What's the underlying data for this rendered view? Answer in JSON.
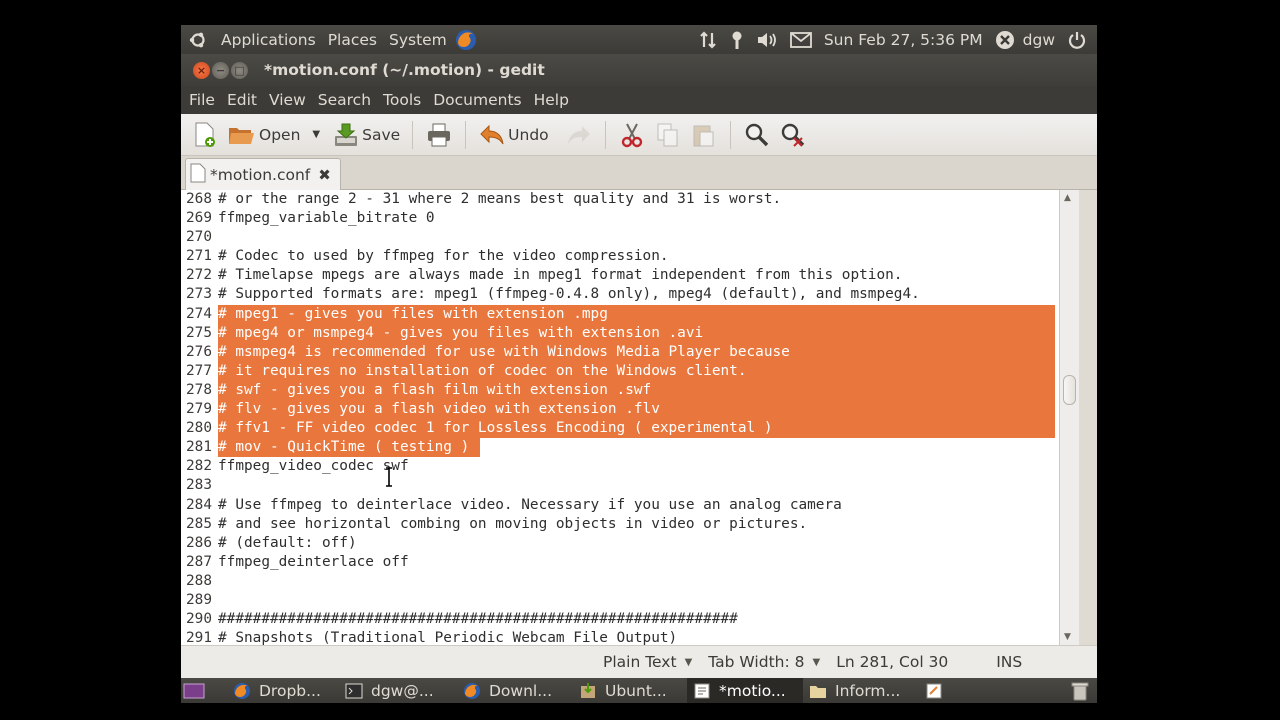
{
  "top_panel": {
    "menus": [
      "Applications",
      "Places",
      "System"
    ],
    "clock": "Sun Feb 27,  5:36 PM",
    "user": "dgw"
  },
  "window": {
    "title": "*motion.conf (~/.motion) - gedit"
  },
  "menubar": [
    "File",
    "Edit",
    "View",
    "Search",
    "Tools",
    "Documents",
    "Help"
  ],
  "toolbar": {
    "open_label": "Open",
    "save_label": "Save",
    "undo_label": "Undo"
  },
  "tab": {
    "label": "*motion.conf"
  },
  "editor": {
    "lines": [
      {
        "n": "268",
        "text": "# or the range 2 - 31 where 2 means best quality and 31 is worst."
      },
      {
        "n": "269",
        "text": "ffmpeg_variable_bitrate 0"
      },
      {
        "n": "270",
        "text": ""
      },
      {
        "n": "271",
        "text": "# Codec to used by ffmpeg for the video compression."
      },
      {
        "n": "272",
        "text": "# Timelapse mpegs are always made in mpeg1 format independent from this option."
      },
      {
        "n": "273",
        "text": "# Supported formats are: mpeg1 (ffmpeg-0.4.8 only), mpeg4 (default), and msmpeg4."
      },
      {
        "n": "274",
        "text": "# mpeg1 - gives you files with extension .mpg"
      },
      {
        "n": "275",
        "text": "# mpeg4 or msmpeg4 - gives you files with extension .avi"
      },
      {
        "n": "276",
        "text": "# msmpeg4 is recommended for use with Windows Media Player because"
      },
      {
        "n": "277",
        "text": "# it requires no installation of codec on the Windows client."
      },
      {
        "n": "278",
        "text": "# swf - gives you a flash film with extension .swf"
      },
      {
        "n": "279",
        "text": "# flv - gives you a flash video with extension .flv"
      },
      {
        "n": "280",
        "text": "# ffv1 - FF video codec 1 for Lossless Encoding ( experimental )"
      },
      {
        "n": "281",
        "text": "# mov - QuickTime ( testing )"
      },
      {
        "n": "282",
        "text": "ffmpeg_video_codec swf"
      },
      {
        "n": "283",
        "text": ""
      },
      {
        "n": "284",
        "text": "# Use ffmpeg to deinterlace video. Necessary if you use an analog camera"
      },
      {
        "n": "285",
        "text": "# and see horizontal combing on moving objects in video or pictures."
      },
      {
        "n": "286",
        "text": "# (default: off)"
      },
      {
        "n": "287",
        "text": "ffmpeg_deinterlace off"
      },
      {
        "n": "288",
        "text": ""
      },
      {
        "n": "289",
        "text": ""
      },
      {
        "n": "290",
        "text": "############################################################"
      },
      {
        "n": "291",
        "text": "# Snapshots (Traditional Periodic Webcam File Output)"
      }
    ]
  },
  "statusbar": {
    "language": "Plain Text",
    "tab_width": "Tab Width: 8",
    "position": "Ln 281, Col 30",
    "mode": "INS"
  },
  "taskbar": [
    "Dropb...",
    "dgw@...",
    "Downl...",
    "Ubunt...",
    "*motio...",
    "Inform..."
  ],
  "colors": {
    "selection": "#e9763c",
    "panel": "#3c3b37"
  }
}
